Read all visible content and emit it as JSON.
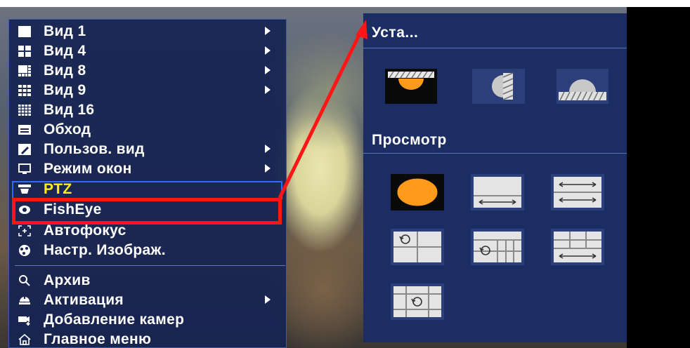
{
  "menu": {
    "items": [
      {
        "label": "Вид 1",
        "icon": "grid-1-icon",
        "submenu": true
      },
      {
        "label": "Вид 4",
        "icon": "grid-4-icon",
        "submenu": true
      },
      {
        "label": "Вид 8",
        "icon": "grid-8-icon",
        "submenu": true
      },
      {
        "label": "Вид 9",
        "icon": "grid-9-icon",
        "submenu": true
      },
      {
        "label": "Вид 16",
        "icon": "grid-16-icon",
        "submenu": false
      },
      {
        "label": "Обход",
        "icon": "tour-icon",
        "submenu": false
      },
      {
        "label": "Пользов. вид",
        "icon": "custom-view-icon",
        "submenu": true
      },
      {
        "label": "Режим окон",
        "icon": "window-mode-icon",
        "submenu": true
      },
      {
        "label": "PTZ",
        "icon": "ptz-icon",
        "submenu": false
      },
      {
        "label": "FishEye",
        "icon": "fisheye-icon",
        "submenu": false
      },
      {
        "label": "Автофокус",
        "icon": "autofocus-icon",
        "submenu": false
      },
      {
        "label": "Настр. Изображ.",
        "icon": "image-settings-icon",
        "submenu": false
      },
      {
        "label": "Архив",
        "icon": "search-icon",
        "submenu": false
      },
      {
        "label": "Активация",
        "icon": "activation-icon",
        "submenu": true
      },
      {
        "label": "Добавление камер",
        "icon": "add-camera-icon",
        "submenu": false
      },
      {
        "label": "Главное меню",
        "icon": "home-icon",
        "submenu": false
      }
    ],
    "highlighted": "PTZ",
    "selected": "FishEye"
  },
  "fisheye_panel": {
    "install_title": "Уста...",
    "view_title": "Просмотр",
    "install_modes": [
      "ceiling-mount-icon",
      "wall-mount-icon",
      "ground-mount-icon"
    ],
    "view_modes": [
      "fisheye-original-icon",
      "panorama-180-icon",
      "panorama-360-icon",
      "fisheye-plus-3-icon",
      "fisheye-plus-8-icon",
      "panorama-plus-6-icon",
      "fisheye-plus-4-icon"
    ]
  },
  "colors": {
    "menu_bg": "#162452",
    "panel_bg": "#1b2d63",
    "highlight_text": "#ffeb1a",
    "selection_frame": "#ff1515",
    "focus_frame": "#2f6bff",
    "accent_orange": "#ff9a1a"
  }
}
